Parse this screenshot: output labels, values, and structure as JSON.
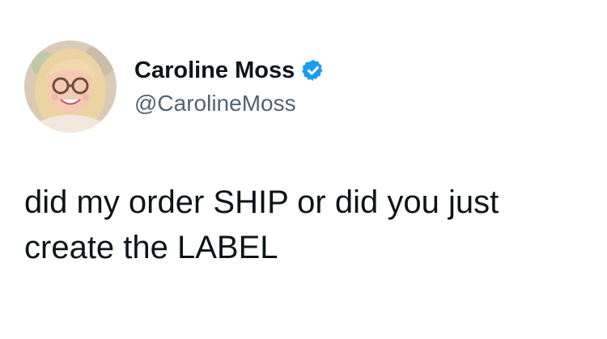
{
  "tweet": {
    "author": {
      "display_name": "Caroline Moss",
      "handle": "@CarolineMoss",
      "verified": true,
      "avatar_icon": "profile-photo"
    },
    "text": "did my order SHIP or did you just\ncreate the LABEL"
  },
  "colors": {
    "background": "#ffffff",
    "name_text": "#0f1419",
    "handle_text": "#536471",
    "verified_badge": "#1d9bf0"
  }
}
